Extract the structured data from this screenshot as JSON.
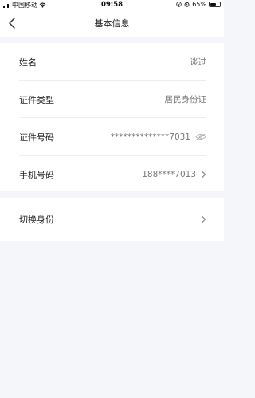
{
  "status_bar": {
    "carrier": "中国移动",
    "time": "09:58",
    "battery": "65%",
    "battery_level": 0.65
  },
  "nav": {
    "title": "基本信息"
  },
  "rows": [
    {
      "label": "姓名",
      "value": "谈过"
    },
    {
      "label": "证件类型",
      "value": "居民身份证"
    },
    {
      "label": "证件号码",
      "value": "**************7031"
    },
    {
      "label": "手机号码",
      "value": "188****7013"
    }
  ],
  "switch_identity": {
    "label": "切换身份"
  },
  "icons": {
    "back": "chevron-left-icon",
    "visibility": "eye-closed-icon",
    "chevron": "chevron-right-icon"
  },
  "colors": {
    "background": "#f4f6f9",
    "card": "#ffffff",
    "text": "#222222",
    "secondary_text": "#777777"
  }
}
